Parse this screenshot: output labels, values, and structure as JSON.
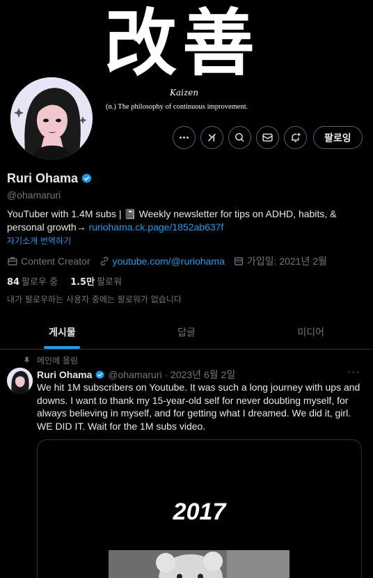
{
  "banner": {
    "kanji": "改善",
    "word": "Kaizen",
    "definition": "(n.) The philosophy of continuous improvement."
  },
  "profile": {
    "name": "Ruri Ohama",
    "handle": "@ohamaruri",
    "bio_text": "YouTuber with 1.4M subs | 📓 Weekly newsletter for tips on ADHD, habits, & personal growth→ ",
    "bio_link": "ruriohama.ck.page/1852ab637f",
    "translate": "자기소개 번역하기",
    "category": "Content Creator",
    "website": "youtube.com/@ruriohama",
    "joined": "가입일: 2021년 2월",
    "following_count": "84",
    "following_label": "팔로우 중",
    "followers_count": "1.5만",
    "followers_label": "팔로워",
    "no_mutual": "내가 팔로우하는 사용자 중에는 팔로워가 없습니다"
  },
  "actions": {
    "follow_label": "팔로잉"
  },
  "tabs": [
    {
      "label": "게시물",
      "active": true
    },
    {
      "label": "답글",
      "active": false
    },
    {
      "label": "미디어",
      "active": false
    }
  ],
  "post": {
    "pinned_label": "메인에 올림",
    "name": "Ruri Ohama",
    "handle_date": "@ohamaruri · 2023년 6월 2일",
    "more": "···",
    "text": "We hit 1M subscribers on Youtube. It was such a long journey with ups and downs. I want to thank my 15-year-old self for never doubting myself, for always believing in myself, and for getting what I dreamed. We did it, girl. WE DID IT. Wait for the 1M subs video.",
    "media_year": "2017"
  },
  "colors": {
    "accent": "#1d9bf0",
    "muted": "#71767b",
    "text": "#e7e9ea",
    "border": "#2f3336"
  }
}
